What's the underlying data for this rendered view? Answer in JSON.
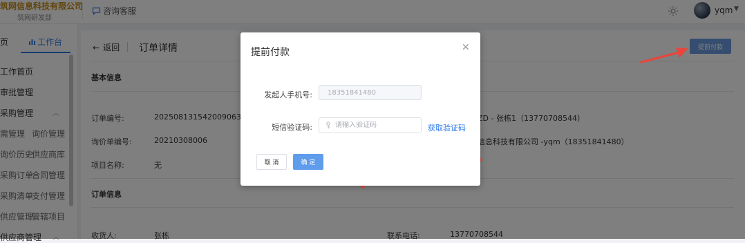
{
  "header": {
    "company": "筑网信息科技有限公司",
    "department": "筑网研发部",
    "service": "咨询客服",
    "user": "yqm"
  },
  "sidebar": {
    "tabs": [
      "页",
      "工作台"
    ],
    "menus": [
      "工作首页",
      "审批管理",
      "采购管理",
      "供应商管理"
    ],
    "subs": [
      "需管理",
      "询价管理",
      "询价历史",
      "供应商库",
      "采购订单",
      "合同管理",
      "采购清单",
      "支付管理",
      "供应管理",
      "管辖项目"
    ]
  },
  "page": {
    "back": "返回",
    "title": "订单详情",
    "prepay_button": "提前付款",
    "section_basic": "基本信息",
    "section_order": "订单信息",
    "order_no_label": "订单编号:",
    "order_no": "202508131542009063",
    "inquiry_no_label": "询价单编号:",
    "inquiry_no": "20210308006",
    "project_label": "项目名称:",
    "project": "无",
    "right_row1": "ZD - 张栋1（13770708544）",
    "right_row2": "信息科技有限公司 -yqm（18351841480）",
    "receiver_label": "收货人:",
    "receiver": "张栋",
    "contact_label": "联系电话:",
    "contact": "13770708544"
  },
  "dialog": {
    "title": "提前付款",
    "phone_label": "发起人手机号:",
    "phone": "18351841480",
    "code_label": "短信验证码:",
    "code_placeholder": "请输入验证码",
    "get_code": "获取验证码",
    "cancel": "取 消",
    "confirm": "确 定"
  },
  "colors": {
    "primary": "#2f7be6",
    "primary_button": "#5f9cec",
    "annotation_arrow": "#e8453c",
    "brand": "#c48b1c"
  }
}
